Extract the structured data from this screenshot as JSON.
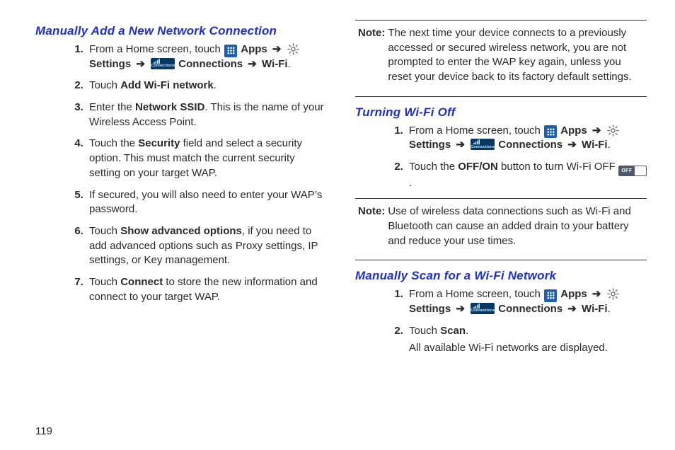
{
  "page_number": "119",
  "sections": {
    "manual_add": {
      "title": "Manually Add a New Network Connection",
      "step1_a": "From a Home screen, touch ",
      "step1_apps": "Apps",
      "step1_settings": "Settings",
      "step1_connections": "Connections",
      "step1_wifi": "Wi-Fi",
      "step2_a": "Touch ",
      "step2_b": "Add Wi-Fi network",
      "step3_a": "Enter the ",
      "step3_b": "Network SSID",
      "step3_c": ". This is the name of your Wireless Access Point.",
      "step4_a": "Touch the ",
      "step4_b": "Security",
      "step4_c": " field and select a security option. This must match the current security setting on your target WAP.",
      "step5": "If secured, you will also need to enter your WAP’s password.",
      "step6_a": "Touch ",
      "step6_b": "Show advanced options",
      "step6_c": ", if you need to add advanced options such as Proxy settings, IP settings, or Key management.",
      "step7_a": "Touch ",
      "step7_b": "Connect",
      "step7_c": " to store the new information and connect to your target WAP."
    },
    "note_top": {
      "label": "Note:",
      "text": "The next time your device connects to a previously accessed or secured wireless network, you are not prompted to enter the WAP key again, unless you reset your device back to its factory default settings."
    },
    "turn_off": {
      "title": "Turning Wi-Fi Off",
      "step1_a": "From a Home screen, touch ",
      "step1_apps": "Apps",
      "step1_settings": "Settings",
      "step1_connections": "Connections",
      "step1_wifi": "Wi-Fi",
      "step2_a": "Touch the ",
      "step2_b": "OFF/ON",
      "step2_c": " button to turn Wi-Fi OFF ",
      "toggle_label": "OFF"
    },
    "note_mid": {
      "label": "Note:",
      "text": "Use of wireless data connections such as Wi-Fi and Bluetooth can cause an added drain to your battery and reduce your use times."
    },
    "scan": {
      "title": "Manually Scan for a Wi-Fi Network",
      "step1_a": "From a Home screen, touch ",
      "step1_apps": "Apps",
      "step1_settings": "Settings",
      "step1_connections": "Connections",
      "step1_wifi": "Wi-Fi",
      "step2_a": "Touch ",
      "step2_b": "Scan",
      "step2_sub": "All available Wi-Fi networks are displayed."
    },
    "icons": {
      "connections_text": "Connections"
    }
  },
  "arrow": "➔"
}
